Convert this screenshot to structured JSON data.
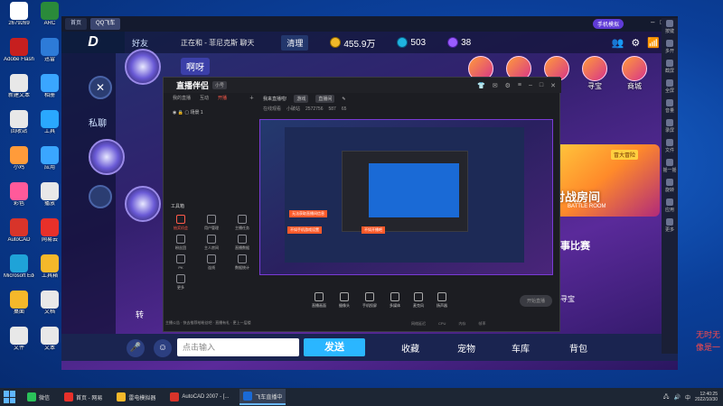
{
  "desktop": {
    "icons": [
      {
        "label": "2679269",
        "color": "#ffffff"
      },
      {
        "label": "ARC",
        "color": "#2a8a3a"
      },
      {
        "label": "Adobe Flash",
        "color": "#c71f1f"
      },
      {
        "label": "迅雷",
        "color": "#2d7bd8"
      },
      {
        "label": "新建文本",
        "color": "#e8e8e8"
      },
      {
        "label": "相册",
        "color": "#3aa6ff"
      },
      {
        "label": "回收站",
        "color": "#e8e8e8"
      },
      {
        "label": "工具",
        "color": "#2aa8ff"
      },
      {
        "label": "小鸡",
        "color": "#ff9b3a"
      },
      {
        "label": "应用",
        "color": "#3aa6ff"
      },
      {
        "label": "彩色",
        "color": "#ff5a9a"
      },
      {
        "label": "播放",
        "color": "#e8e8e8"
      },
      {
        "label": "AutoCAD",
        "color": "#d8342a"
      },
      {
        "label": "网易云",
        "color": "#e8302a"
      },
      {
        "label": "Microsoft Edge",
        "color": "#1fa3d8"
      },
      {
        "label": "工具箱",
        "color": "#f5b82a"
      },
      {
        "label": "桌面",
        "color": "#f5b82a"
      },
      {
        "label": "文档",
        "color": "#e8e8e8"
      },
      {
        "label": "文件",
        "color": "#e8e8e8"
      },
      {
        "label": "文本",
        "color": "#e8e8e8"
      }
    ]
  },
  "game": {
    "tabs": [
      "首页",
      "QQ飞车"
    ],
    "tag": "手机模拟",
    "friends_tab": "好友",
    "online_text": "正在和 - 菲尼克斯  聊天",
    "clear_label": "清理",
    "coins": "455.9万",
    "gems": "503",
    "points": "38",
    "private_chat": "私聊",
    "bubble": "啊呀",
    "input_placeholder": "点击输入",
    "send_label": "发送",
    "nav": [
      "收藏",
      "宠物",
      "车库",
      "背包"
    ],
    "features": [
      "寻宝",
      "商城"
    ],
    "battle_room": "对战房间",
    "battle_room_en": "BATTLE ROOM",
    "adventure": "冒大冒险",
    "match": "事比赛",
    "treasure": "寻宝",
    "forward": "转",
    "sidebar_items": [
      "按键",
      "多开",
      "截屏",
      "全屏",
      "音量",
      "录屏",
      "文件",
      "摇一摇",
      "旋转",
      "应用",
      "更多"
    ]
  },
  "live": {
    "app_name": "直播伴侣",
    "version": "小号",
    "tabs": [
      "我的直播",
      "互动",
      "开播"
    ],
    "scene": "场景 1",
    "stream_title": "我来直播啦!",
    "category": "游戏",
    "sub_category": "直播间",
    "stream_tags": [
      "在线观看",
      "小破站",
      "2572756",
      "587",
      "65"
    ],
    "toolbox_title": "工具箱",
    "tools": [
      {
        "label": "抽奖机会",
        "hot": true
      },
      {
        "label": "用户管理",
        "hot": false
      },
      {
        "label": "主播任务",
        "hot": false
      },
      {
        "label": "粉丝团",
        "hot": false
      },
      {
        "label": "主人房间",
        "hot": false
      },
      {
        "label": "直播数据",
        "hot": false
      },
      {
        "label": "PK",
        "hot": false
      },
      {
        "label": "连线",
        "hot": false
      },
      {
        "label": "数据统计",
        "hot": false
      },
      {
        "label": "更多",
        "hot": false
      }
    ],
    "preview_tags": [
      "无法获取直播间信息",
      "不如手机游戏设置",
      "不如开播吧"
    ],
    "bottom_buttons": [
      "直播画面",
      "摄像头",
      "手机投屏",
      "多媒体",
      "麦克风",
      "扬声器"
    ],
    "start_live": "开始直播",
    "left_tip": "主播公告 · 快去推荐给粉丝吧 · 直播有礼 · 更上一层楼",
    "status": [
      "网络延迟",
      "CPU",
      "内存",
      "帧率"
    ]
  },
  "side_texts": [
    "无时无",
    "像是一"
  ],
  "taskbar": {
    "items": [
      {
        "label": "微信",
        "color": "#2ac15a",
        "active": false
      },
      {
        "label": "首页 - 网易",
        "color": "#e8302a",
        "active": false
      },
      {
        "label": "雷电模拟器",
        "color": "#f5b82a",
        "active": false
      },
      {
        "label": "AutoCAD 2007 - [...",
        "color": "#d8342a",
        "active": false
      },
      {
        "label": "飞车直播中",
        "color": "#1a6ad6",
        "active": true
      }
    ],
    "time": "12:40:25",
    "date": "2022/10/30"
  }
}
